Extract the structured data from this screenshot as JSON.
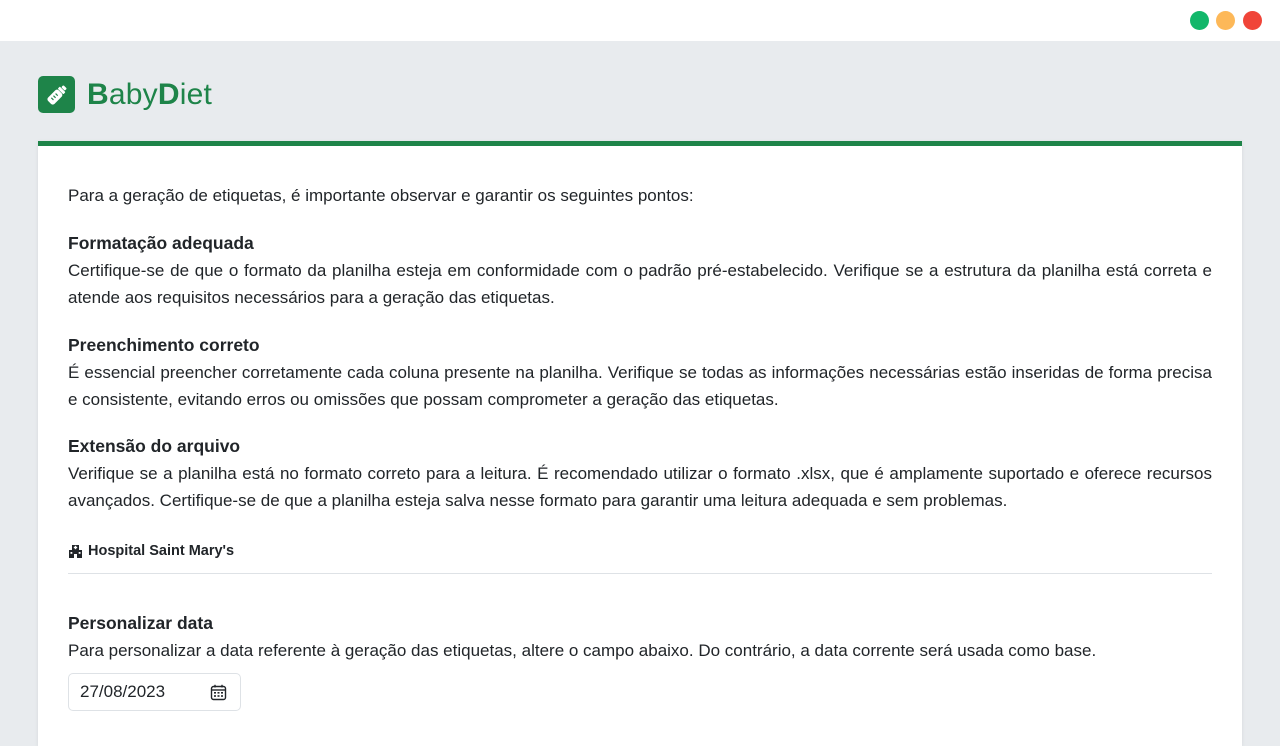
{
  "window": {
    "controls": [
      {
        "name": "green",
        "color": "#12b76a"
      },
      {
        "name": "yellow",
        "color": "#fdb858"
      },
      {
        "name": "red",
        "color": "#f04438"
      }
    ]
  },
  "brand": {
    "name_part1_bold": "B",
    "name_part1_rest": "aby",
    "name_part2_bold": "D",
    "name_part2_rest": "iet",
    "logo_icon": "baby-bottle-icon",
    "color": "#1e8449"
  },
  "content": {
    "intro": "Para a geração de etiquetas, é importante observar e garantir os seguintes pontos:",
    "sections": [
      {
        "title": "Formatação adequada",
        "text": "Certifique-se de que o formato da planilha esteja em conformidade com o padrão pré-estabelecido. Verifique se a estrutura da planilha está correta e atende aos requisitos necessários para a geração das etiquetas."
      },
      {
        "title": "Preenchimento correto",
        "text": "É essencial preencher corretamente cada coluna presente na planilha. Verifique se todas as informações necessárias estão inseridas de forma precisa e consistente, evitando erros ou omissões que possam comprometer a geração das etiquetas."
      },
      {
        "title": "Extensão do arquivo",
        "text": "Verifique se a planilha está no formato correto para a leitura. É recomendado utilizar o formato .xlsx, que é amplamente suportado e oferece recursos avançados. Certifique-se de que a planilha esteja salva nesse formato para garantir uma leitura adequada e sem problemas."
      }
    ],
    "hospital": {
      "icon": "hospital-icon",
      "name": "Hospital Saint Mary's"
    },
    "custom_date": {
      "title": "Personalizar data",
      "text": "Para personalizar a data referente à geração das etiquetas, altere o campo abaixo. Do contrário, a data corrente será usada como base.",
      "value": "27/08/2023",
      "icon": "calendar-icon"
    }
  }
}
